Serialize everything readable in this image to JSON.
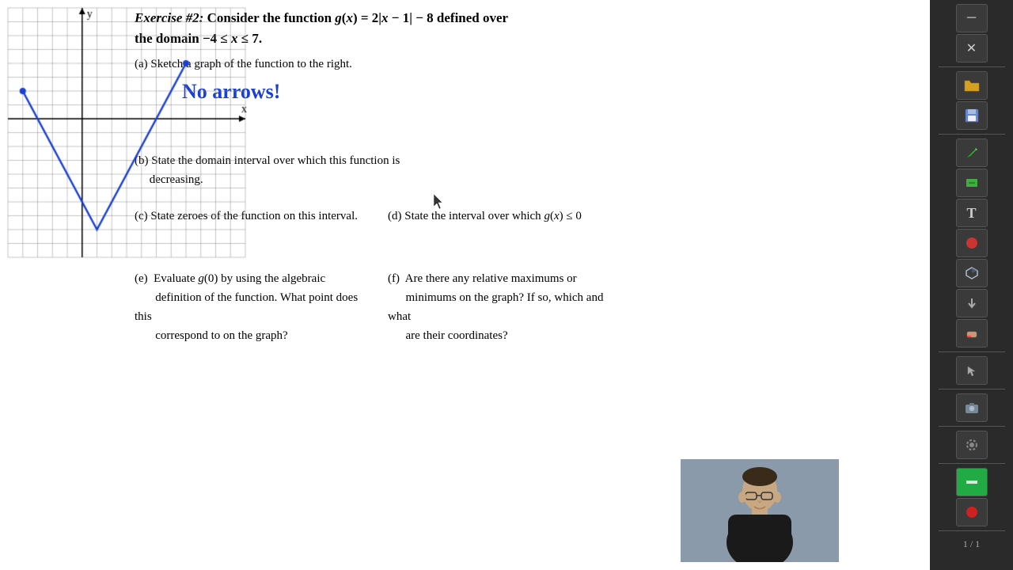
{
  "exercise": {
    "number": "Exercise #2:",
    "description": "Consider the function g(x) = 2|x − 1| − 8 defined over the domain −4 ≤ x ≤ 7.",
    "parts": {
      "a": {
        "label": "(a)",
        "text": "Sketch a graph of the function to the right.",
        "handwritten": "No arrows!"
      },
      "b": {
        "label": "(b)",
        "text": "State the domain interval over which this function is decreasing."
      },
      "c": {
        "label": "(c)",
        "text": "State zeroes of the function on this interval."
      },
      "d": {
        "label": "(d)",
        "text": "State the interval over which g(x) ≤ 0"
      },
      "e": {
        "label": "(e)",
        "text": "Evaluate g(0) by using the algebraic definition of the function. What point does this correspond to on the graph?"
      },
      "f": {
        "label": "(f)",
        "text": "Are there any relative maximums or minimums on the graph? If so, which and what are their coordinates?"
      }
    }
  },
  "toolbar": {
    "items": [
      {
        "name": "minimize-icon",
        "symbol": "─"
      },
      {
        "name": "close-icon",
        "symbol": "✕"
      },
      {
        "name": "folder-icon",
        "symbol": "🗂"
      },
      {
        "name": "save-icon",
        "symbol": "💾"
      },
      {
        "name": "pen-icon",
        "symbol": "✏"
      },
      {
        "name": "highlight-icon",
        "symbol": "▐"
      },
      {
        "name": "text-icon",
        "symbol": "T"
      },
      {
        "name": "shapes-icon",
        "symbol": "◉"
      },
      {
        "name": "3d-icon",
        "symbol": "⬡"
      },
      {
        "name": "arrow-icon",
        "symbol": "→"
      },
      {
        "name": "eraser-icon",
        "symbol": "◻"
      },
      {
        "name": "select-icon",
        "symbol": "⊹"
      },
      {
        "name": "camera-icon",
        "symbol": "📷"
      },
      {
        "name": "settings-icon",
        "symbol": "⚙"
      },
      {
        "name": "green-box-icon",
        "symbol": "▬"
      },
      {
        "name": "red-circle-icon",
        "symbol": "●"
      },
      {
        "name": "page-label",
        "symbol": "1/1"
      }
    ]
  },
  "page": {
    "number": "1 / 1"
  }
}
